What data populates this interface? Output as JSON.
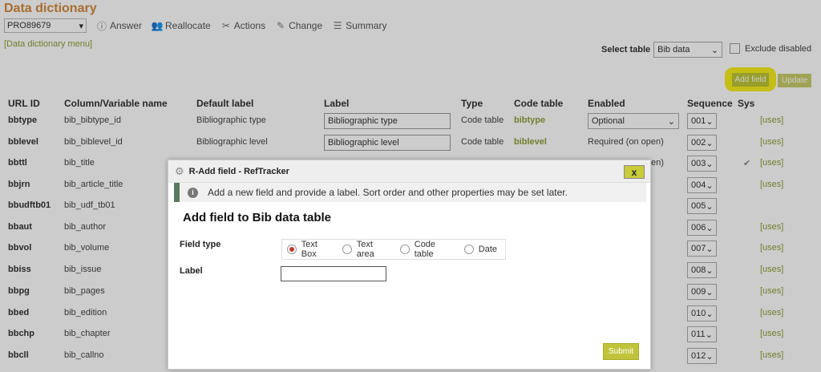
{
  "header": {
    "title": "Data dictionary",
    "pro_value": "PRO89679",
    "toolbar": [
      {
        "label": "Answer",
        "icon": "info-icon"
      },
      {
        "label": "Reallocate",
        "icon": "users-icon"
      },
      {
        "label": "Actions",
        "icon": "tools-icon"
      },
      {
        "label": "Change",
        "icon": "edit-icon"
      },
      {
        "label": "Summary",
        "icon": "list-icon"
      }
    ],
    "menu_link": "[Data dictionary menu]"
  },
  "controls": {
    "select_table_label": "Select table",
    "select_table_value": "Bib data",
    "exclude_disabled": "Exclude disabled",
    "add_field": "Add field",
    "update": "Update"
  },
  "table": {
    "headers": [
      "URL ID",
      "Column/Variable name",
      "Default label",
      "Label",
      "Type",
      "Code table",
      "Enabled",
      "Sequence",
      "Sys"
    ],
    "rows": [
      {
        "id": "bbtype",
        "var": "bib_bibtype_id",
        "def": "Bibliographic type",
        "label": "Bibliographic type",
        "type": "Code table",
        "code": "bibtype",
        "enabled": "Optional",
        "seq": "001",
        "sys": "",
        "uses": "[uses]"
      },
      {
        "id": "bblevel",
        "var": "bib_biblevel_id",
        "def": "Bibliographic level",
        "label": "Bibliographic level",
        "type": "Code table",
        "code": "biblevel",
        "enabled": "Required (on open)",
        "seq": "002",
        "sys": "",
        "uses": "[uses]"
      },
      {
        "id": "bbttl",
        "var": "bib_title",
        "def": "",
        "label": "",
        "type": "",
        "code": "",
        "enabled": "en)",
        "seq": "003",
        "sys": "✔",
        "uses": "[uses]"
      },
      {
        "id": "bbjrn",
        "var": "bib_article_title",
        "def": "",
        "label": "",
        "type": "",
        "code": "",
        "enabled": "",
        "seq": "004",
        "sys": "",
        "uses": "[uses]"
      },
      {
        "id": "bbudftb01",
        "var": "bib_udf_tb01",
        "def": "",
        "label": "",
        "type": "",
        "code": "",
        "enabled": "",
        "seq": "005",
        "sys": "",
        "uses": ""
      },
      {
        "id": "bbaut",
        "var": "bib_author",
        "def": "",
        "label": "",
        "type": "",
        "code": "",
        "enabled": "",
        "seq": "006",
        "sys": "",
        "uses": "[uses]"
      },
      {
        "id": "bbvol",
        "var": "bib_volume",
        "def": "",
        "label": "",
        "type": "",
        "code": "",
        "enabled": "",
        "seq": "007",
        "sys": "",
        "uses": "[uses]"
      },
      {
        "id": "bbiss",
        "var": "bib_issue",
        "def": "",
        "label": "",
        "type": "",
        "code": "",
        "enabled": "",
        "seq": "008",
        "sys": "",
        "uses": "[uses]"
      },
      {
        "id": "bbpg",
        "var": "bib_pages",
        "def": "",
        "label": "",
        "type": "",
        "code": "",
        "enabled": "",
        "seq": "009",
        "sys": "",
        "uses": "[uses]"
      },
      {
        "id": "bbed",
        "var": "bib_edition",
        "def": "",
        "label": "",
        "type": "",
        "code": "",
        "enabled": "",
        "seq": "010",
        "sys": "",
        "uses": "[uses]"
      },
      {
        "id": "bbchp",
        "var": "bib_chapter",
        "def": "",
        "label": "",
        "type": "",
        "code": "",
        "enabled": "",
        "seq": "011",
        "sys": "",
        "uses": "[uses]"
      },
      {
        "id": "bbcll",
        "var": "bib_callno",
        "def": "",
        "label": "",
        "type": "",
        "code": "",
        "enabled": "",
        "seq": "012",
        "sys": "",
        "uses": "[uses]"
      }
    ]
  },
  "dialog": {
    "window_title": "R-Add field - RefTracker",
    "close": "x",
    "info": "Add a new field and provide a label. Sort order and other properties may be set later.",
    "heading": "Add field to Bib data table",
    "field_type_label": "Field type",
    "field_types": [
      "Text Box",
      "Text area",
      "Code table",
      "Date"
    ],
    "selected_type": "Text Box",
    "label_label": "Label",
    "label_value": "",
    "submit": "Submit"
  }
}
